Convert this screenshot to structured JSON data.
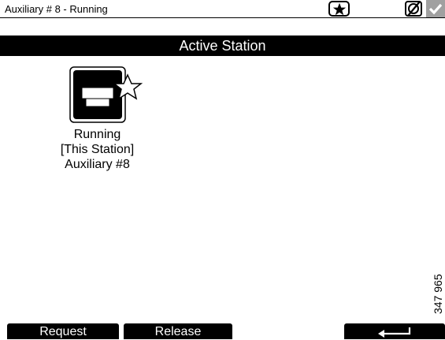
{
  "status_bar": {
    "title": "Auxiliary # 8 - Running",
    "icons": [
      "star-icon",
      "no-signal-icon",
      "checkmark-icon"
    ]
  },
  "header": {
    "title": "Active Station"
  },
  "station": {
    "icon": "station-star-icon",
    "status": "Running",
    "location": "[This Station]",
    "name": "Auxiliary #8"
  },
  "reference_code": "347 965",
  "soft_keys": {
    "request": "Request",
    "release": "Release",
    "back_icon": "return-arrow-icon"
  },
  "colors": {
    "bar": "#000000",
    "background": "#ffffff",
    "check_bg": "#a0a0a0"
  }
}
